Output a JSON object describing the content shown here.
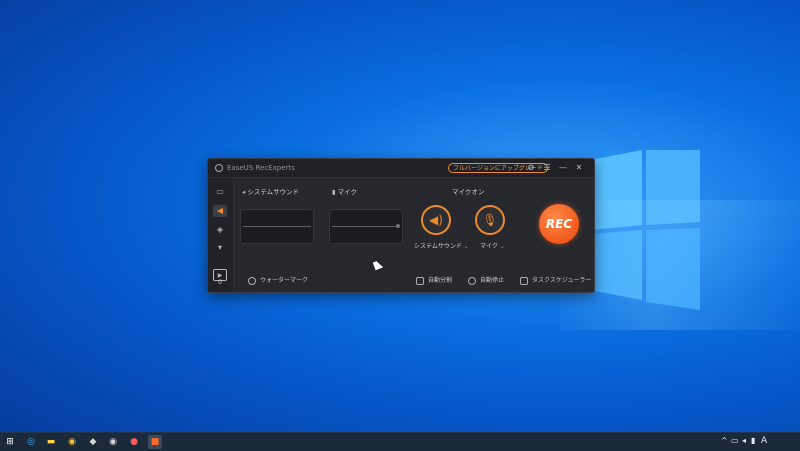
{
  "app": {
    "title": "EaseUS RecExperts",
    "upgrade_label": "フルバージョンにアップグレード"
  },
  "sidebar": {
    "items": [
      {
        "name": "screen",
        "icon": "monitor-icon"
      },
      {
        "name": "audio",
        "icon": "speaker-icon"
      },
      {
        "name": "game",
        "icon": "gamepad-icon"
      },
      {
        "name": "more",
        "icon": "chevron-down-icon"
      }
    ],
    "recordings_count": "0"
  },
  "audio": {
    "system_sound_label": "システムサウンド",
    "mic_label": "マイク",
    "mic_on_label": "マイクオン",
    "system_sound_dropdown": "システムサウンド",
    "mic_dropdown": "マイク"
  },
  "rec_label": "REC",
  "bottom": {
    "watermark": "ウォーターマーク",
    "auto_split": "自動分割",
    "auto_stop": "自動停止",
    "task_scheduler": "タスクスケジューラー"
  },
  "tray": {
    "ime": "A"
  },
  "colors": {
    "accent": "#f08a2a",
    "window_bg": "#26282e",
    "desktop": "#0a6fe0"
  }
}
